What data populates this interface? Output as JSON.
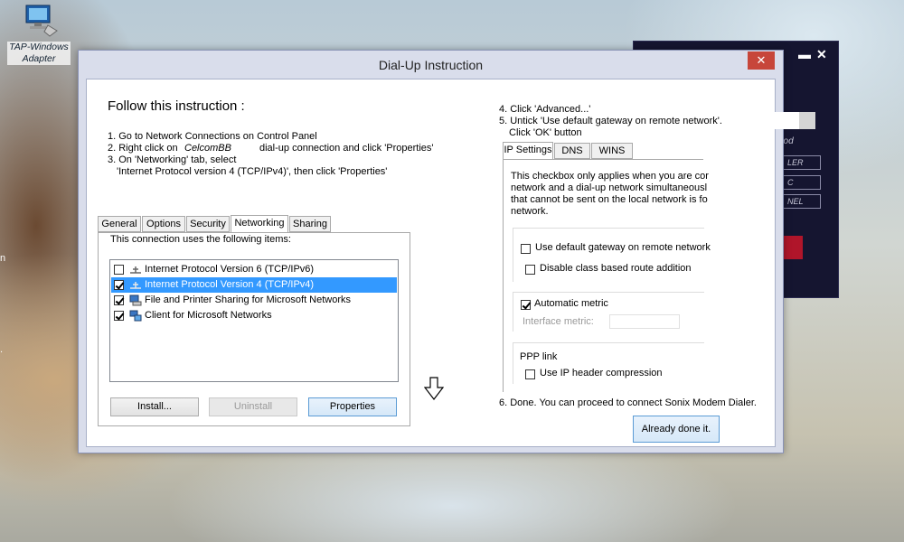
{
  "desktop": {
    "icon_label_1": "TAP-Windows",
    "icon_label_2": "Adapter",
    "edge_text_1": "n",
    "edge_text_2": "."
  },
  "background_window": {
    "minimize": "▬",
    "close": "✕",
    "italic_text": "hod",
    "buttons": [
      "LER",
      "C",
      "NEL"
    ]
  },
  "dialog": {
    "title": "Dial-Up Instruction",
    "close": "✕",
    "heading": "Follow this instruction :",
    "steps": {
      "s1": "1. Go to Network Connections on Control Panel",
      "s2a": "2. Right click on",
      "s2b": "CelcomBB",
      "s2c": "dial-up connection and click 'Properties'",
      "s3a": "3. On 'Networking' tab, select",
      "s3b": "'Internet Protocol version 4 (TCP/IPv4)', then click 'Properties'",
      "s4": "4. Click 'Advanced...'",
      "s5a": "5. Untick 'Use default gateway on remote network'.",
      "s5b": "Click 'OK' button",
      "s6": "6. Done. You can proceed to connect Sonix Modem Dialer."
    },
    "tabs": [
      "General",
      "Options",
      "Security",
      "Networking",
      "Sharing"
    ],
    "list_caption": "This connection uses the following items:",
    "items": [
      {
        "label": "Internet Protocol Version 6 (TCP/IPv6)",
        "checked": false
      },
      {
        "label": "Internet Protocol Version 4 (TCP/IPv4)",
        "checked": true
      },
      {
        "label": "File and Printer Sharing for Microsoft Networks",
        "checked": true
      },
      {
        "label": "Client for Microsoft Networks",
        "checked": true
      }
    ],
    "buttons": {
      "install": "Install...",
      "uninstall": "Uninstall",
      "properties": "Properties"
    },
    "ip_tabs": [
      "IP Settings",
      "DNS",
      "WINS"
    ],
    "ip_desc": [
      "This checkbox only applies when you are cor",
      "network and a dial-up network simultaneousl",
      "that cannot be sent on the local network is fo",
      "network."
    ],
    "ip_options": {
      "default_gateway": "Use default gateway on remote network",
      "disable_class": "Disable class based route addition",
      "automatic_metric": "Automatic metric",
      "interface_metric": "Interface metric:",
      "ppp_link": "PPP link",
      "ip_header": "Use IP header compression"
    },
    "done_button": "Already done it."
  }
}
